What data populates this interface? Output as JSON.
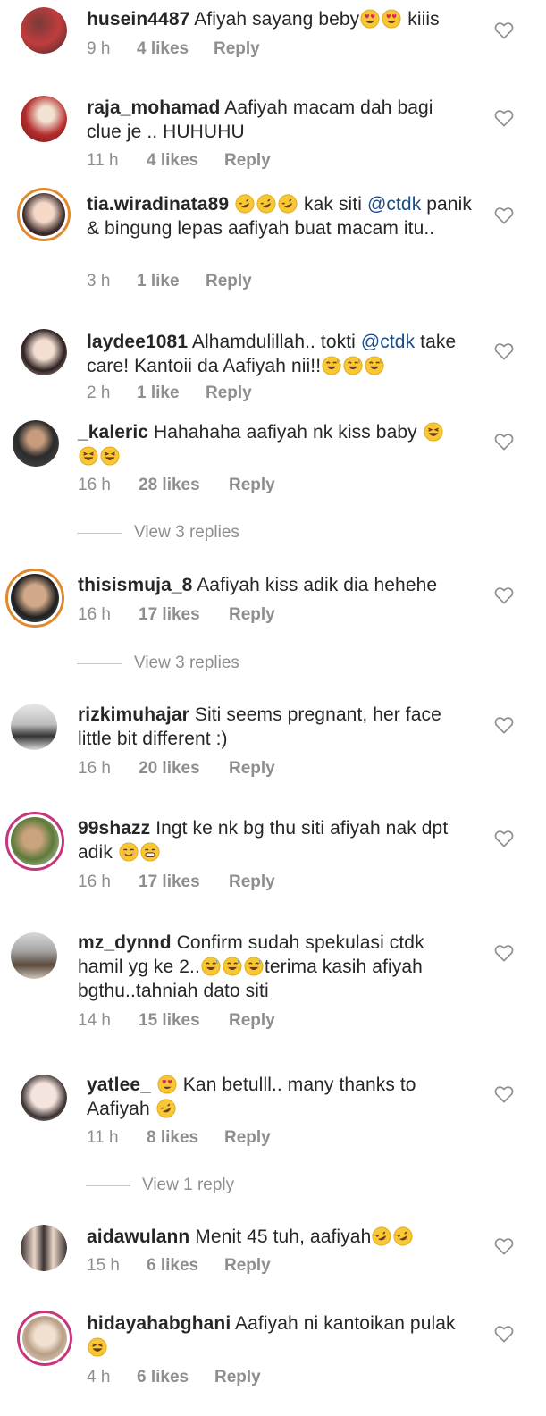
{
  "comments": [
    {
      "user": "husein4487",
      "text": "Afiyah sayang beby",
      "emojis": [
        "heart-eyes-emoji",
        "heart-eyes-emoji"
      ],
      "after": " kiiis",
      "time": "9 h",
      "likes": "4 likes",
      "reply": "Reply"
    },
    {
      "user": "raja_mohamad",
      "text": "Aafiyah macam dah bagi clue je .. HUHUHU",
      "time": "11 h",
      "likes": "4 likes",
      "reply": "Reply"
    },
    {
      "user": "tia.wiradinata89",
      "emojis": [
        "rofl-emoji",
        "rofl-emoji",
        "rofl-emoji"
      ],
      "pre": " kak siti ",
      "mention": "@ctdk",
      "text2": " panik & bingung lepas aafiyah buat macam itu..",
      "time": "3 h",
      "likes": "1 like",
      "reply": "Reply"
    },
    {
      "user": "laydee1081",
      "text": "Alhamdulillah.. tokti ",
      "mention": "@ctdk",
      "text2": " take care! Kantoii da Aafiyah nii!!",
      "emojis": [
        "sweat-smile-emoji",
        "sweat-smile-emoji",
        "sweat-smile-emoji"
      ],
      "time": "2 h",
      "likes": "1 like",
      "reply": "Reply"
    },
    {
      "user": "_kaleric",
      "text": "Hahahaha aafiyah nk kiss baby",
      "emojis": [
        "laughing-emoji",
        "laughing-emoji",
        "laughing-emoji"
      ],
      "time": "16 h",
      "likes": "28 likes",
      "reply": "Reply",
      "view_replies": "View 3 replies"
    },
    {
      "user": "thisismuja_8",
      "text": "Aafiyah kiss adik dia hehehe",
      "time": "16 h",
      "likes": "17 likes",
      "reply": "Reply",
      "view_replies": "View 3 replies"
    },
    {
      "user": "rizkimuhajar",
      "text": "Siti seems pregnant, her face little bit different :)",
      "time": "16 h",
      "likes": "20 likes",
      "reply": "Reply"
    },
    {
      "user": "99shazz",
      "text": "Ingt ke nk bg thu siti afiyah nak dpt adik",
      "emojis": [
        "smile-emoji",
        "grin-emoji"
      ],
      "time": "16 h",
      "likes": "17 likes",
      "reply": "Reply"
    },
    {
      "user": "mz_dynnd",
      "text": "Confirm sudah spekulasi ctdk hamil yg ke 2..",
      "emojis": [
        "sweat-smile-emoji",
        "sweat-smile-emoji",
        "sweat-smile-emoji"
      ],
      "after": "terima kasih afiyah bgthu..tahniah dato siti",
      "time": "14 h",
      "likes": "15 likes",
      "reply": "Reply"
    },
    {
      "user": "yatlee_",
      "emojis": [
        "heart-eyes-emoji"
      ],
      "pre": " Kan betulll.. many thanks to Aafiyah",
      "emojis2": [
        "rofl-emoji"
      ],
      "time": "11 h",
      "likes": "8 likes",
      "reply": "Reply",
      "view_replies": "View 1 reply"
    },
    {
      "user": "aidawulann",
      "text": "Menit 45 tuh, aafiyah",
      "emojis": [
        "rofl-emoji",
        "rofl-emoji"
      ],
      "time": "15 h",
      "likes": "6 likes",
      "reply": "Reply"
    },
    {
      "user": "hidayahabghani",
      "text": "Aafiyah ni kantoikan pulak",
      "emojis": [
        "laughing-emoji"
      ],
      "time": "4 h",
      "likes": "6 likes",
      "reply": "Reply"
    }
  ],
  "colors": {
    "username": "#262626",
    "meta": "#8e8e8e",
    "mention": "#1a4e86",
    "ring": "#e08a2e",
    "heart": "#8e8e8e"
  }
}
